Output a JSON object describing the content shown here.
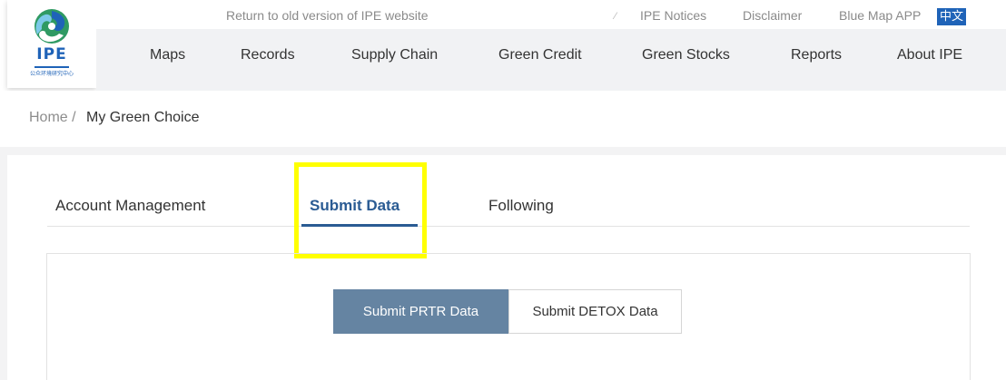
{
  "header": {
    "logo": {
      "text": "IPE",
      "subtitle": "公众环境研究中心"
    },
    "topbar": {
      "old_version_link": "Return to old version of IPE website",
      "separator": "⁄",
      "notices": "IPE Notices",
      "disclaimer": "Disclaimer",
      "blue_map_app": "Blue Map APP",
      "language": "中文"
    },
    "nav": {
      "items": [
        {
          "label": "Maps"
        },
        {
          "label": "Records"
        },
        {
          "label": "Supply Chain"
        },
        {
          "label": "Green Credit"
        },
        {
          "label": "Green Stocks"
        },
        {
          "label": "Reports"
        },
        {
          "label": "About IPE"
        }
      ]
    }
  },
  "breadcrumb": {
    "home": "Home",
    "separator": "/",
    "current": "My Green Choice"
  },
  "tabs": [
    {
      "label": "Account Management"
    },
    {
      "label": "Submit Data",
      "active": true
    },
    {
      "label": "Following"
    }
  ],
  "actions": {
    "submit_prtr": "Submit PRTR Data",
    "submit_detox": "Submit DETOX Data"
  },
  "colors": {
    "brand_blue": "#1f63b8",
    "active_tab": "#2a5b93",
    "primary_button": "#6584a2",
    "highlight": "#ffff00"
  }
}
